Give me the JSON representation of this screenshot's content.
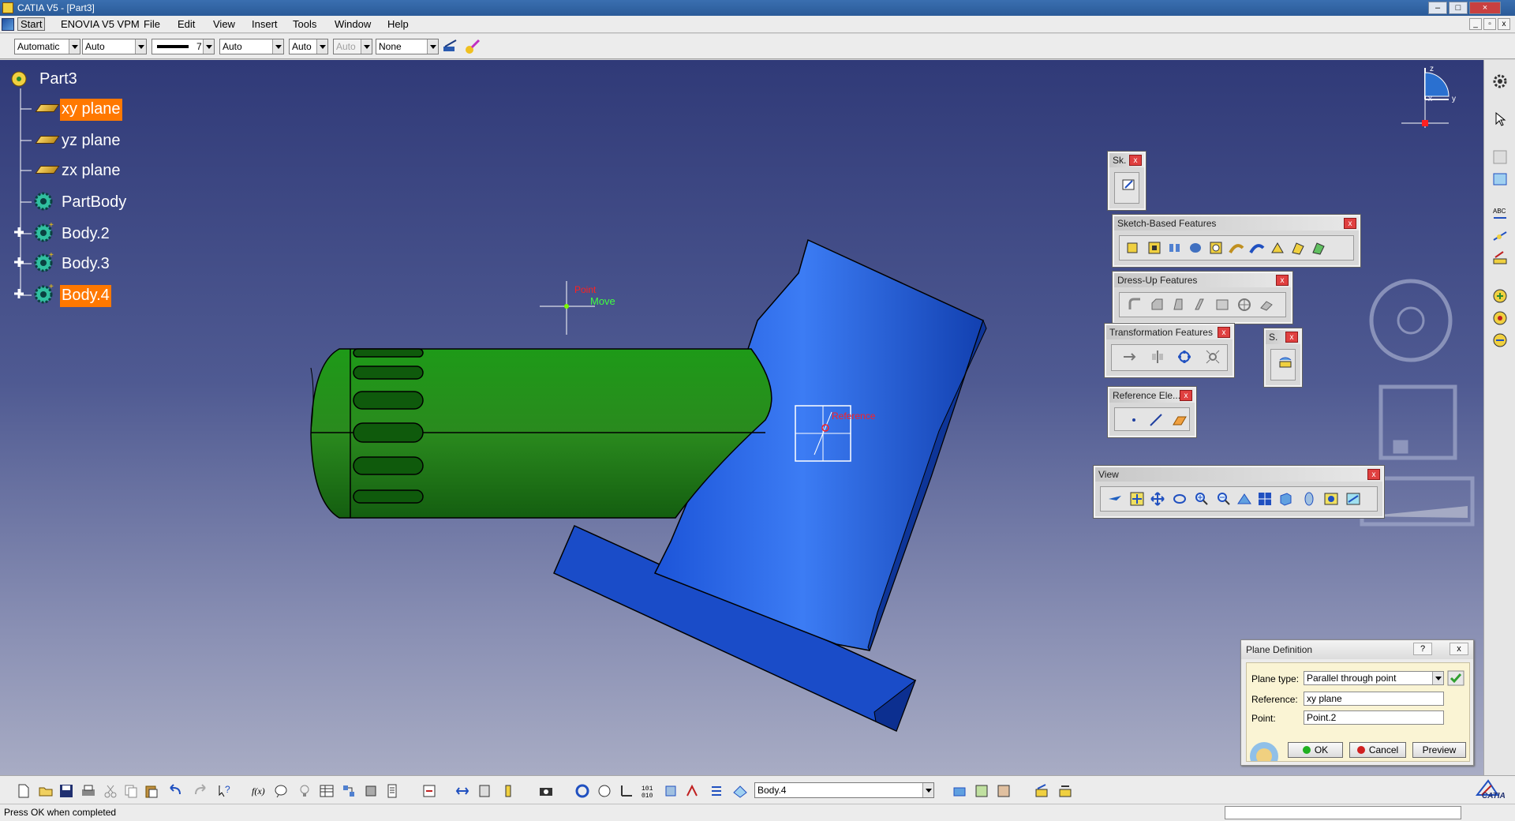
{
  "window": {
    "title": "CATIA V5 - [Part3]"
  },
  "menu": {
    "items": [
      "Start",
      "ENOVIA V5 VPM",
      "File",
      "Edit",
      "View",
      "Insert",
      "Tools",
      "Window",
      "Help"
    ]
  },
  "properties_toolbar": {
    "color": "Automatic",
    "transparency": "Auto",
    "line_thickness": "7",
    "line_type": "Auto",
    "point_type": "Auto",
    "layer_disabled": "Auto",
    "layer": "None"
  },
  "tree": {
    "root": "Part3",
    "items": [
      {
        "label": "xy plane",
        "icon": "plane-icon",
        "selected": true
      },
      {
        "label": "yz plane",
        "icon": "plane-icon",
        "selected": false
      },
      {
        "label": "zx plane",
        "icon": "plane-icon",
        "selected": false
      },
      {
        "label": "PartBody",
        "icon": "body-icon",
        "selected": false
      },
      {
        "label": "Body.2",
        "icon": "body-icon",
        "selected": false,
        "expandable": true
      },
      {
        "label": "Body.3",
        "icon": "body-icon",
        "selected": false,
        "expandable": true
      },
      {
        "label": "Body.4",
        "icon": "body-icon",
        "selected": true,
        "expandable": true
      }
    ]
  },
  "viewport": {
    "point_label": "Point",
    "move_label": "Move",
    "reference_label": "Reference",
    "compass": {
      "x": "x",
      "y": "y",
      "z": "z"
    }
  },
  "toolbars": {
    "sketcher": "Sk.",
    "sketch_based": "Sketch-Based Features",
    "dress_up": "Dress-Up Features",
    "transformation": "Transformation Features",
    "surface": "S.",
    "reference": "Reference Ele...",
    "view": "View"
  },
  "plane_dialog": {
    "title": "Plane Definition",
    "help": "?",
    "close": "x",
    "plane_type_label": "Plane type:",
    "plane_type_value": "Parallel through point",
    "reference_label": "Reference:",
    "reference_value": "xy plane",
    "point_label": "Point:",
    "point_value": "Point.2",
    "ok": "OK",
    "cancel": "Cancel",
    "preview": "Preview"
  },
  "bottom_toolbar": {
    "current_body": "Body.4"
  },
  "brand": "CATIA",
  "status": {
    "message": "Press OK when completed"
  },
  "colors": {
    "green_body": "#1e7a14",
    "blue_body": "#1e5fe0",
    "selection": "#ff7800",
    "viewport_top": "#303a78",
    "viewport_bottom": "#a8acc4"
  }
}
